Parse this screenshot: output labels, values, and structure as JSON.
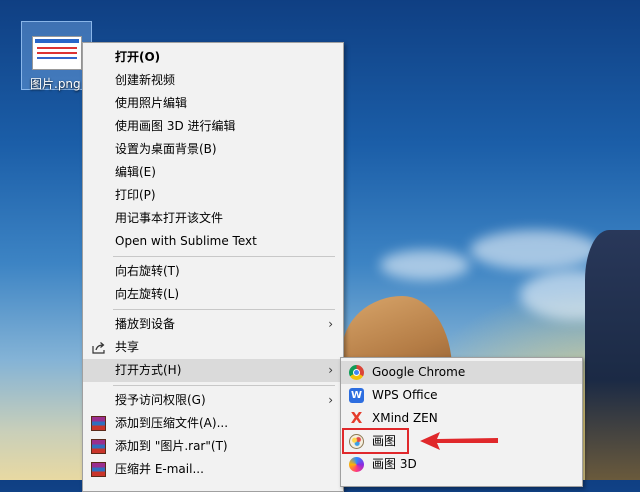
{
  "desktop_icon": {
    "label": "图片.png"
  },
  "context_menu": {
    "items": [
      {
        "label": "打开(O)"
      },
      {
        "label": "创建新视频"
      },
      {
        "label": "使用照片编辑"
      },
      {
        "label": "使用画图 3D 进行编辑"
      },
      {
        "label": "设置为桌面背景(B)"
      },
      {
        "label": "编辑(E)"
      },
      {
        "label": "打印(P)"
      },
      {
        "label": "用记事本打开该文件"
      },
      {
        "label": "Open with Sublime Text"
      },
      {
        "label": "向右旋转(T)"
      },
      {
        "label": "向左旋转(L)"
      },
      {
        "label": "播放到设备",
        "arrow": "›"
      },
      {
        "label": "共享",
        "icon": "share-icon"
      },
      {
        "label": "打开方式(H)",
        "arrow": "›"
      },
      {
        "label": "授予访问权限(G)",
        "arrow": "›"
      },
      {
        "label": "添加到压缩文件(A)...",
        "icon": "winrar-icon"
      },
      {
        "label": "添加到 \"图片.rar\"(T)",
        "icon": "winrar-icon"
      },
      {
        "label": "压缩并 E-mail...",
        "icon": "winrar-icon"
      }
    ]
  },
  "open_with_submenu": {
    "items": [
      {
        "label": "Google Chrome",
        "icon": "chrome-icon"
      },
      {
        "label": "WPS Office",
        "icon": "wps-icon",
        "icon_text": "W"
      },
      {
        "label": "XMind ZEN",
        "icon": "xmind-icon",
        "icon_text": "X"
      },
      {
        "label": "画图",
        "icon": "paint-icon"
      },
      {
        "label": "画图 3D",
        "icon": "paint3d-icon"
      }
    ]
  },
  "colors": {
    "highlight": "#e0282b",
    "menu_bg": "#f2f2f2",
    "hover": "#dadada"
  }
}
